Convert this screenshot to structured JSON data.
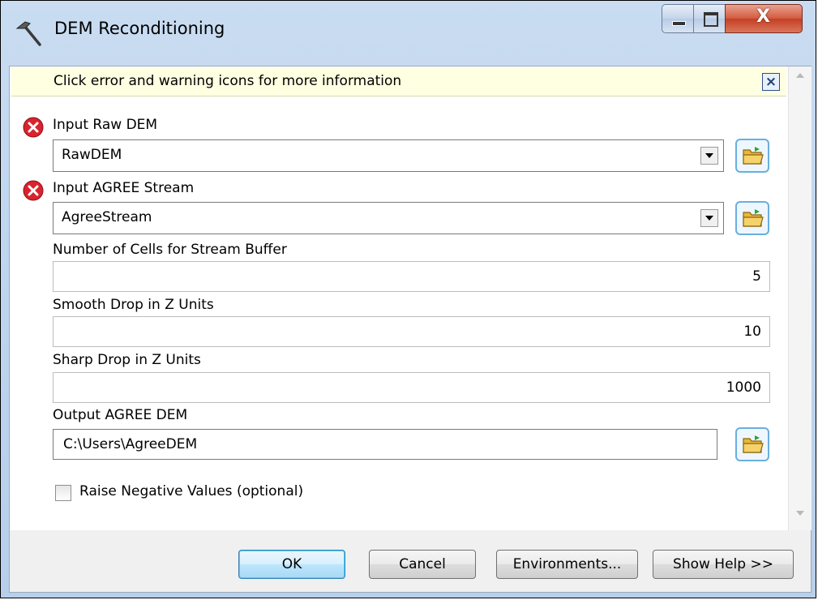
{
  "window": {
    "title": "DEM Reconditioning",
    "icon": "hammer-icon",
    "controls": {
      "minimize": "minimize-icon",
      "maximize": "maximize-icon",
      "close": "close-icon"
    }
  },
  "banner": {
    "text": "Click error and warning icons for more information",
    "close_icon": "close-x-icon"
  },
  "params": {
    "raw_dem": {
      "label": "Input Raw DEM",
      "value": "RawDEM",
      "status_icon": "error-icon"
    },
    "agree_stream": {
      "label": "Input AGREE Stream",
      "value": "AgreeStream",
      "status_icon": "error-icon"
    },
    "buffer_cells": {
      "label": "Number of Cells for Stream Buffer",
      "value": "5"
    },
    "smooth_drop": {
      "label": "Smooth Drop in Z Units",
      "value": "10"
    },
    "sharp_drop": {
      "label": "Sharp Drop in Z Units",
      "value": "1000"
    },
    "output_dem": {
      "label": "Output AGREE DEM",
      "value": "C:\\Users\\AgreeDEM"
    },
    "raise_negative": {
      "label": "Raise Negative Values (optional)",
      "checked": false
    }
  },
  "buttons": {
    "ok": "OK",
    "cancel": "Cancel",
    "environments": "Environments...",
    "show_help": "Show Help >>"
  },
  "colors": {
    "banner_bg": "#ffffe1",
    "error_red": "#d9232e",
    "titlebar": "#c9dcf1",
    "ok_border": "#3c7fb1"
  }
}
